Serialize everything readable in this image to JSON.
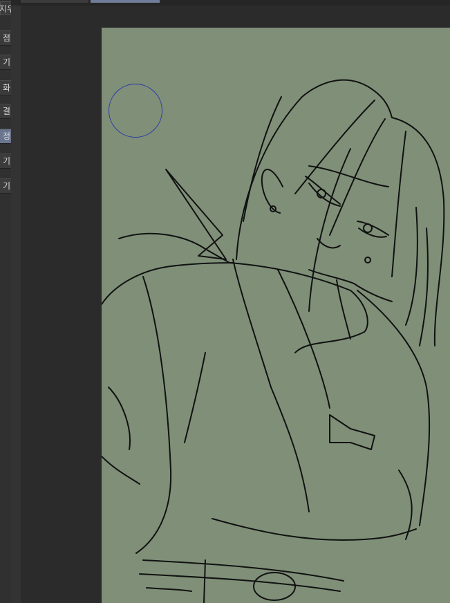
{
  "sidebar": {
    "top_label": "지우기",
    "items": [
      {
        "label": "점",
        "active": false
      },
      {
        "label": "기",
        "active": false
      },
      {
        "label": "화",
        "active": false
      },
      {
        "label": "결",
        "active": false
      },
      {
        "label": "정",
        "active": true
      },
      {
        "label": "기",
        "active": false
      },
      {
        "label": "기",
        "active": false
      }
    ]
  },
  "canvas": {
    "background_color": "#7f8f78",
    "line_color": "#111111",
    "brush_cursor_color": "#2c3aa8"
  },
  "icons": [
    "brush-cursor-circle"
  ]
}
